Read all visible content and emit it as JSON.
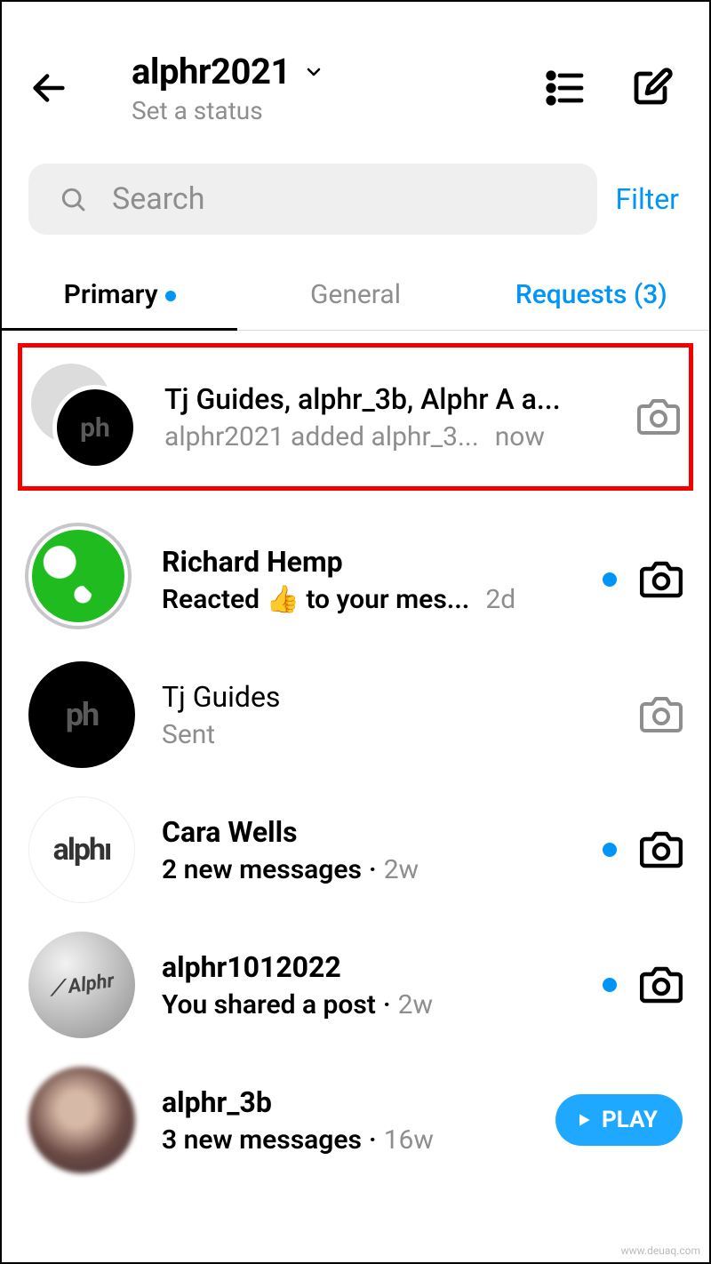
{
  "header": {
    "username": "alphr2021",
    "set_status": "Set a status"
  },
  "search": {
    "placeholder": "Search",
    "filter_label": "Filter"
  },
  "tabs": {
    "primary": "Primary",
    "general": "General",
    "requests": "Requests (3)"
  },
  "threads": [
    {
      "title": "Tj Guides, alphr_3b, Alphr A a...",
      "snippet": "alphr2021 added alphr_3...",
      "time": "now",
      "camera_style": "gray",
      "unread_dot": false,
      "avatar": "group",
      "highlighted": true
    },
    {
      "title": "Richard Hemp",
      "snippet": "Reacted 👍 to your mes...",
      "time": "2d",
      "camera_style": "black",
      "unread_dot": true,
      "bold": true,
      "avatar": "green",
      "story_ring": true
    },
    {
      "title": "Tj Guides",
      "snippet": "Sent",
      "time": "",
      "camera_style": "gray",
      "unread_dot": false,
      "avatar": "black"
    },
    {
      "title": "Cara Wells",
      "snippet": "2 new messages",
      "time": "2w",
      "camera_style": "black",
      "unread_dot": true,
      "bold": true,
      "avatar": "white"
    },
    {
      "title": "alphr1012022",
      "snippet": "You shared a post",
      "time": "2w",
      "camera_style": "black",
      "unread_dot": true,
      "bold": true,
      "avatar": "gray"
    },
    {
      "title": "alphr_3b",
      "snippet": "3 new messages",
      "time": "16w",
      "play_button": "PLAY",
      "unread_dot": false,
      "bold": true,
      "avatar": "blur"
    }
  ],
  "watermark": "www.deuaq.com"
}
